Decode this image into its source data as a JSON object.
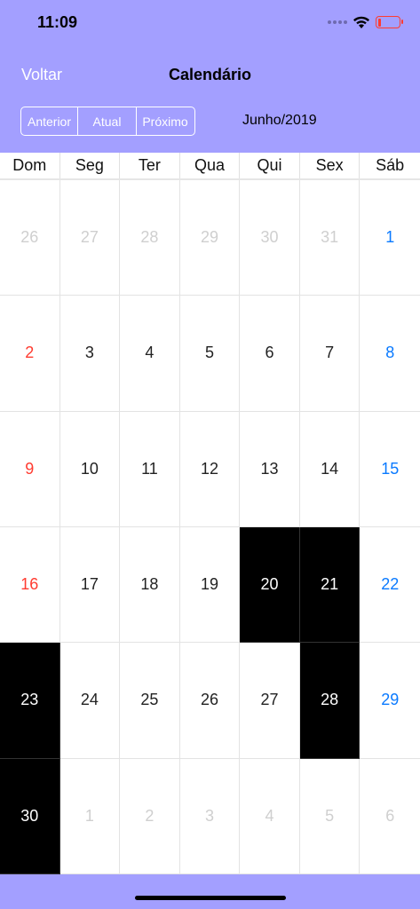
{
  "status_bar": {
    "time": "11:09"
  },
  "nav": {
    "back_label": "Voltar",
    "title": "Calendário"
  },
  "segments": [
    "Anterior",
    "Atual",
    "Próximo"
  ],
  "month_label": "Junho/2019",
  "weekdays": [
    "Dom",
    "Seg",
    "Ter",
    "Qua",
    "Qui",
    "Sex",
    "Sáb"
  ],
  "colors": {
    "header_bg": "#a39fff",
    "sunday": "#ff3b30",
    "saturday": "#0a7aff",
    "other_month": "#cfcfcf",
    "selected_bg": "#000000"
  },
  "days": [
    {
      "label": "26",
      "state": "other"
    },
    {
      "label": "27",
      "state": "other"
    },
    {
      "label": "28",
      "state": "other"
    },
    {
      "label": "29",
      "state": "other"
    },
    {
      "label": "30",
      "state": "other"
    },
    {
      "label": "31",
      "state": "other"
    },
    {
      "label": "1",
      "state": "sat"
    },
    {
      "label": "2",
      "state": "sun"
    },
    {
      "label": "3",
      "state": ""
    },
    {
      "label": "4",
      "state": ""
    },
    {
      "label": "5",
      "state": ""
    },
    {
      "label": "6",
      "state": ""
    },
    {
      "label": "7",
      "state": ""
    },
    {
      "label": "8",
      "state": "sat"
    },
    {
      "label": "9",
      "state": "sun"
    },
    {
      "label": "10",
      "state": ""
    },
    {
      "label": "11",
      "state": ""
    },
    {
      "label": "12",
      "state": ""
    },
    {
      "label": "13",
      "state": ""
    },
    {
      "label": "14",
      "state": ""
    },
    {
      "label": "15",
      "state": "sat"
    },
    {
      "label": "16",
      "state": "sun"
    },
    {
      "label": "17",
      "state": ""
    },
    {
      "label": "18",
      "state": ""
    },
    {
      "label": "19",
      "state": ""
    },
    {
      "label": "20",
      "state": "sel"
    },
    {
      "label": "21",
      "state": "sel"
    },
    {
      "label": "22",
      "state": "sat"
    },
    {
      "label": "23",
      "state": "sel"
    },
    {
      "label": "24",
      "state": ""
    },
    {
      "label": "25",
      "state": ""
    },
    {
      "label": "26",
      "state": ""
    },
    {
      "label": "27",
      "state": ""
    },
    {
      "label": "28",
      "state": "sel"
    },
    {
      "label": "29",
      "state": "sat"
    },
    {
      "label": "30",
      "state": "sel"
    },
    {
      "label": "1",
      "state": "other"
    },
    {
      "label": "2",
      "state": "other"
    },
    {
      "label": "3",
      "state": "other"
    },
    {
      "label": "4",
      "state": "other"
    },
    {
      "label": "5",
      "state": "other"
    },
    {
      "label": "6",
      "state": "other"
    }
  ]
}
